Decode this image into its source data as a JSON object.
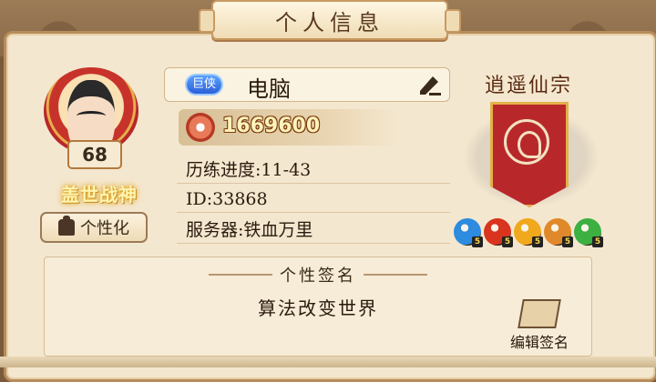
{
  "window": {
    "title": "个人信息"
  },
  "profile": {
    "level": "68",
    "honor_title": "盖世战神",
    "persona_button": "个性化",
    "vip_badge": "巨侠",
    "name": "电脑",
    "power": "1669600",
    "progress": "历练进度:11-43",
    "id": "ID:33868",
    "server": "服务器:铁血万里"
  },
  "sect": {
    "name": "逍遥仙宗",
    "banner_color": "#b8282a",
    "orbs": [
      {
        "icon": "water-element-icon",
        "color": "#2d8be0",
        "level": "5"
      },
      {
        "icon": "fire-element-icon",
        "color": "#d8341e",
        "level": "5"
      },
      {
        "icon": "sun-element-icon",
        "color": "#f0a81c",
        "level": "5"
      },
      {
        "icon": "beast-element-icon",
        "color": "#e0892a",
        "level": "5"
      },
      {
        "icon": "wood-element-icon",
        "color": "#3cb040",
        "level": "5"
      }
    ]
  },
  "signature": {
    "title": "个性签名",
    "text": "算法改变世界",
    "edit_label": "编辑签名"
  }
}
